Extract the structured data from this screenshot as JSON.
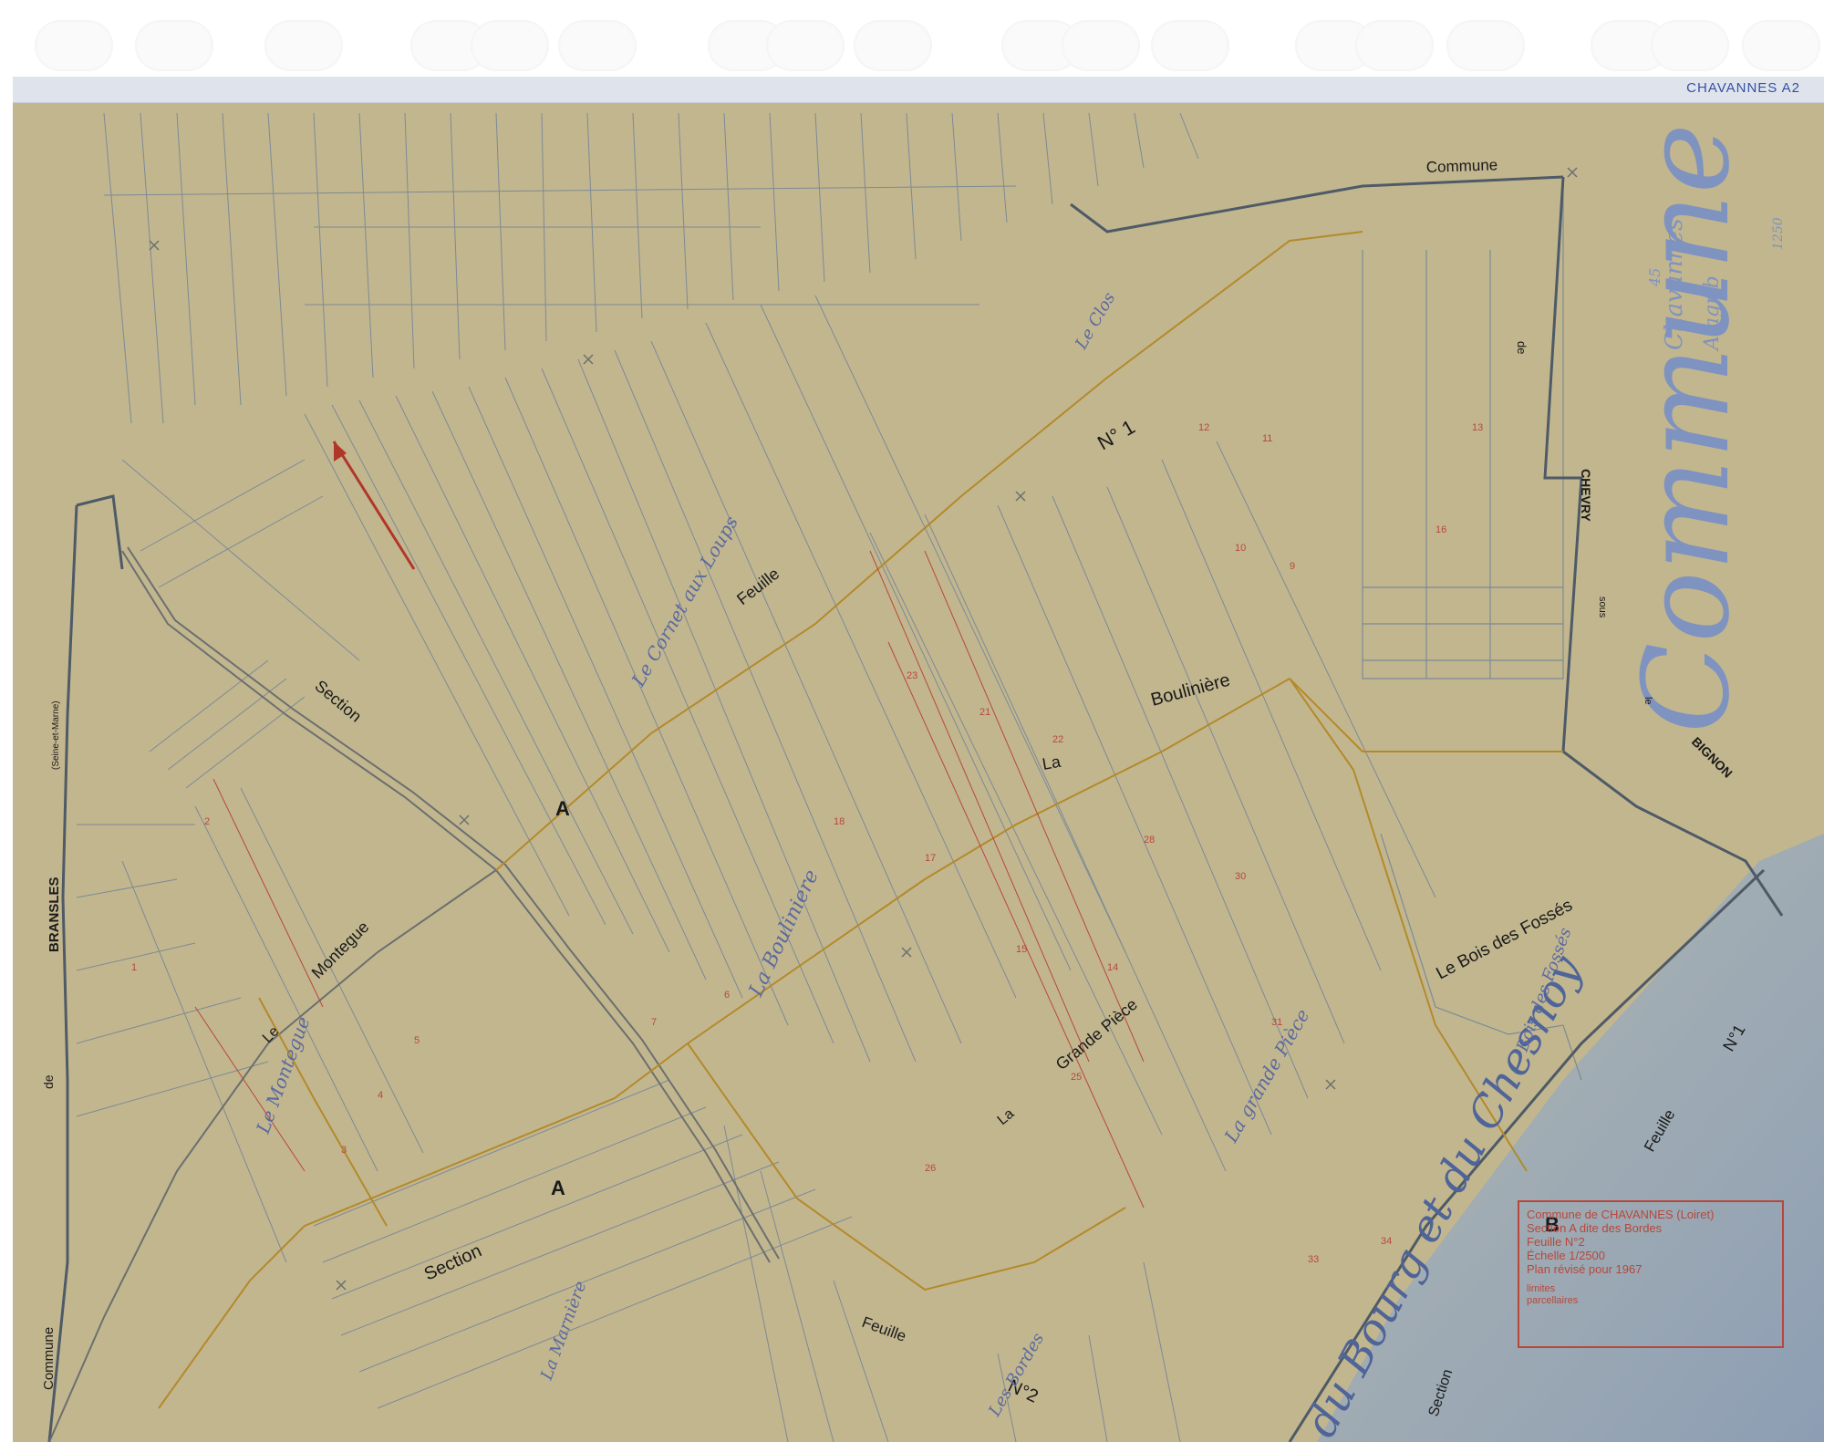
{
  "sheet": {
    "reference_code": "CHAVANNES A2"
  },
  "labels": {
    "commune_top": "Commune",
    "commune_big": "Commune",
    "chavannes": "Chavannes",
    "a_agr_b": "A agr b",
    "num_45": "45",
    "num_1250": "1250",
    "de": "de",
    "chevry": "CHEVRY",
    "sous": "sous",
    "le": "le",
    "bignon": "BIGNON",
    "feuille_1": "Feuille",
    "no_1_top": "N° 1",
    "section_1": "Section",
    "a_1": "A",
    "la_bouliniere_la": "La",
    "la_bouliniere": "Boulinière",
    "le_montegue_le": "Le",
    "le_montegue": "Montegue",
    "bois_des_fosses": "Le Bois des Fossés",
    "la_grande_piece_la": "La",
    "la_grande_piece": "Grande Pièce",
    "section_2": "Section",
    "a_2": "A",
    "feuille_2": "Feuille",
    "no_2": "N°2",
    "feuille_3": "Feuille",
    "no_1_right": "N°1",
    "b": "B",
    "section_3": "Section",
    "commune_left": "Commune",
    "de_left": "de",
    "bransles": "BRANSLES",
    "seine_et_marne": "(Seine-et-Marne)",
    "du_bourg": "du Bourg et du Chesnoy",
    "script_1": "Le Cornet aux Loups",
    "script_2": "La Bouliniere",
    "script_3": "Le Montegue",
    "script_4": "La grande Pièce",
    "script_5": "Bois des Fossés",
    "script_6": "Les Bordes",
    "script_7": "La Marnière",
    "script_8": "Le Clos"
  },
  "title_block": {
    "line1": "Commune de CHAVANNES (Loiret)",
    "line2": "Section A dite des Bordes",
    "line3": "Feuille N°2",
    "line4": "Échelle 1/2500",
    "line5": "Plan révisé pour 1967",
    "legend1": "limites",
    "legend2": "parcellaires"
  },
  "colors": {
    "paper": "#c2b68f",
    "pencil_line": "#7d8a95",
    "road_line": "#6b6f6e",
    "section_boundary": "#b38a2a",
    "annotation_red": "#b8473a",
    "river_blue": "#8fa8c8"
  }
}
